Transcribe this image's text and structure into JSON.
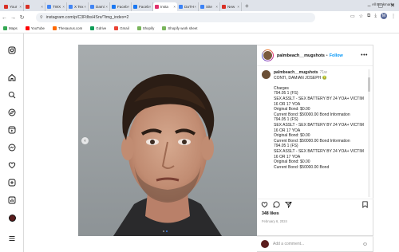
{
  "browser": {
    "tabs": [
      {
        "label": "Your",
        "color": "#d93025"
      },
      {
        "label": "",
        "color": "#d93025"
      },
      {
        "label": "TWX",
        "color": "#4285f4"
      },
      {
        "label": "X Tex",
        "color": "#4285f4"
      },
      {
        "label": "Dami",
        "color": "#4285f4"
      },
      {
        "label": "Faceb",
        "color": "#1877f2"
      },
      {
        "label": "Faceb",
        "color": "#1877f2"
      },
      {
        "label": "Insta",
        "color": "#e1306c",
        "active": true
      },
      {
        "label": "DaTH",
        "color": "#3b82f6"
      },
      {
        "label": "Site",
        "color": "#3b82f6"
      },
      {
        "label": "New",
        "color": "#d93025"
      }
    ],
    "url": "instagram.com/p/C3FtIbsHSnr/?img_index=2",
    "bookmarks": [
      {
        "label": "Maps",
        "color": "#34a853"
      },
      {
        "label": "YouTube",
        "color": "#ff0000"
      },
      {
        "label": "Thesaurus.com",
        "color": "#ff6a00"
      },
      {
        "label": "Gdrive",
        "color": "#0f9d58"
      },
      {
        "label": "Gmail",
        "color": "#ea4335"
      },
      {
        "label": "Shopify",
        "color": "#7ab55c"
      },
      {
        "label": "Shopify work sheet",
        "color": "#7ab55c"
      }
    ],
    "all_bookmarks": "All Bookmarks"
  },
  "post": {
    "username": "palmbeach__mugshots",
    "follow_label": "Follow",
    "caption_user": "palmbeach__mugshots",
    "caption_time": "71w",
    "caption_body": "CONTI, DAMIAN JOSEPH 🤢\n\nCharges\n794.05 1 (FS)\nSEX ASSLT - SEX BATTERY BY 24 YOA+ VICTIM 16 OR 17 YOA\nOriginal Bond: $0.00\nCurrent Bond: $50000.00 Bond Information\n794.05 1 (FS)\nSEX ASSLT - SEX BATTERY BY 24 YOA+ VICTIM 16 OR 17 YOA\nOriginal Bond: $0.00\nCurrent Bond: $50000.00 Bond Information\n794.05 1 (FS)\nSEX ASSLT - SEX BATTERY BY 24 YOA+ VICTIM 16 OR 17 YOA\nOriginal Bond: $0.00\nCurrent Bond: $50000.00 Bond",
    "likes": "348 likes",
    "date": "February 6, 2024",
    "comment_placeholder": "Add a comment..."
  }
}
